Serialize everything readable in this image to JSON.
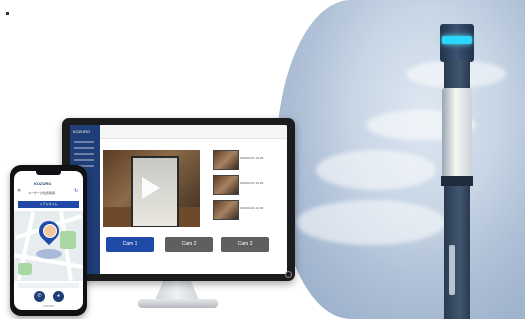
{
  "monitor": {
    "brand": "KOZURO",
    "cameras": [
      {
        "label": "Cam 1",
        "active": true
      },
      {
        "label": "Cam 2",
        "active": false
      },
      {
        "label": "Cam 3",
        "active": false
      }
    ],
    "thumbnails": [
      {
        "label": "2020/01/01 10:28"
      },
      {
        "label": "2020/01/01 10:29"
      },
      {
        "label": "2020/01/01 10:30"
      }
    ],
    "colors": {
      "active_button": "#1f4aa8",
      "inactive_button": "#5f5f5f",
      "sidebar": "#1f3d76"
    }
  },
  "phone": {
    "brand": "KOZURO",
    "title": "ユーザーの位置情報",
    "close_icon": "close-icon",
    "refresh_icon": "refresh-icon",
    "banner": "リアルタイム",
    "call_icon": "phone-icon",
    "chat_icon": "camera-icon"
  },
  "scene": {
    "lamp_accent": "#2bd6ff"
  }
}
